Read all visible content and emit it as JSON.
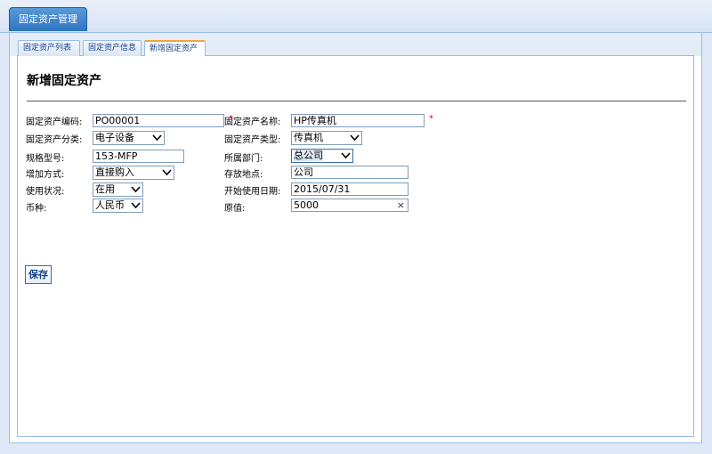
{
  "main_tab": "固定资产管理",
  "sub_tabs": [
    "固定资产列表",
    "固定资产信息",
    "新增固定资产"
  ],
  "form": {
    "title": "新增固定资产",
    "required_mark": "*",
    "code": {
      "label": "固定资产编码:",
      "value": "PO00001"
    },
    "name": {
      "label": "固定资产名称:",
      "value": "HP传真机"
    },
    "category": {
      "label": "固定资产分类:",
      "value": "电子设备"
    },
    "type": {
      "label": "固定资产类型:",
      "value": "传真机"
    },
    "model": {
      "label": "规格型号:",
      "value": "153-MFP"
    },
    "department": {
      "label": "所属部门:",
      "value": "总公司"
    },
    "increase_method": {
      "label": "增加方式:",
      "value": "直接购入"
    },
    "location": {
      "label": "存放地点:",
      "value": "公司"
    },
    "usage_status": {
      "label": "使用状况:",
      "value": "在用"
    },
    "start_date": {
      "label": "开始使用日期:",
      "value": "2015/07/31"
    },
    "currency": {
      "label": "币种:",
      "value": "人民币"
    },
    "original_value": {
      "label": "原值:",
      "value": "5000",
      "clear_icon": "×"
    },
    "save_label": "保存"
  },
  "colors": {
    "accent": "#2e74c2",
    "border": "#99bbe8",
    "active_tab_top": "#f0a640",
    "required": "#e00000"
  }
}
